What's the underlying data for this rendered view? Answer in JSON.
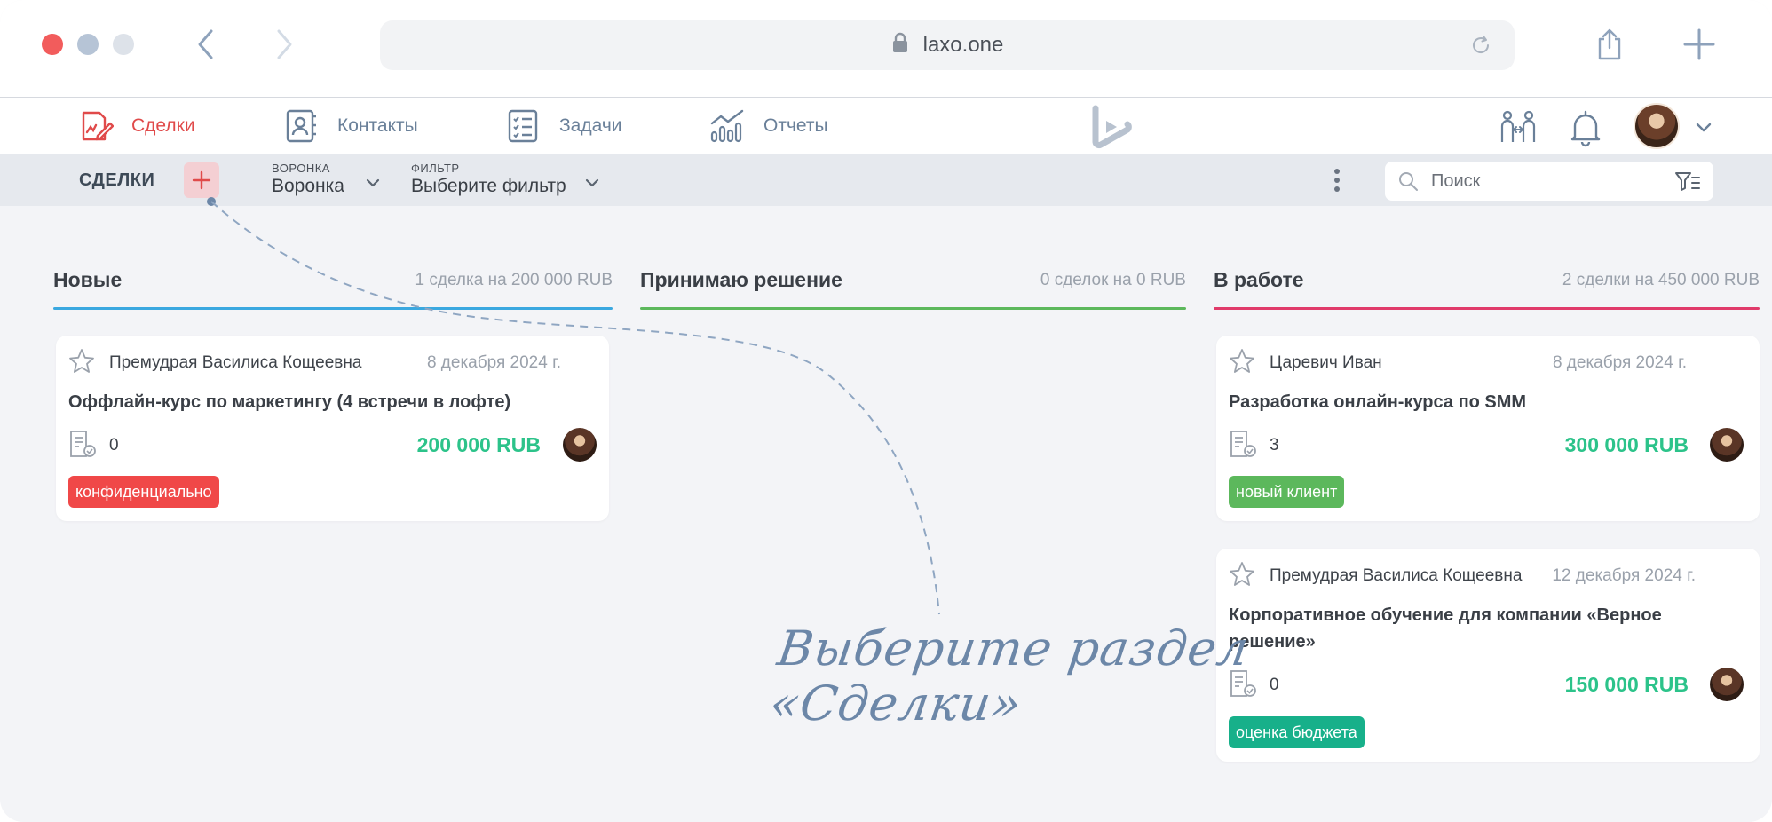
{
  "browser": {
    "url": "laxo.one"
  },
  "nav": {
    "items": [
      {
        "label": "Сделки",
        "icon": "deals-icon",
        "active": true
      },
      {
        "label": "Контакты",
        "icon": "contacts-icon",
        "active": false
      },
      {
        "label": "Задачи",
        "icon": "tasks-icon",
        "active": false
      },
      {
        "label": "Отчеты",
        "icon": "reports-icon",
        "active": false
      }
    ]
  },
  "toolbar": {
    "title": "СДЕЛКИ",
    "funnel_label": "ВОРОНКА",
    "funnel_value": "Воронка",
    "filter_label": "ФИЛЬТР",
    "filter_value": "Выберите фильтр",
    "search_placeholder": "Поиск"
  },
  "colors": {
    "accent": "#e04a4a",
    "amount": "#2cc38a",
    "col_new": "#3aa8e0",
    "col_decide": "#5cb85c",
    "col_work": "#e03a6a",
    "tag_confidential": "#f04848",
    "tag_new_client": "#5cb85c",
    "tag_budget": "#17b08a"
  },
  "columns": [
    {
      "name": "Новые",
      "summary": "1 сделка на 200 000 RUB",
      "cards": [
        {
          "owner": "Премудрая Василиса Кощеевна",
          "date": "8 декабря 2024 г.",
          "title": "Оффлайн-курс по маркетингу (4 встречи в лофте)",
          "count": "0",
          "amount": "200 000 RUB",
          "tag": "конфиденциально"
        }
      ]
    },
    {
      "name": "Принимаю решение",
      "summary": "0 сделок на 0 RUB",
      "cards": []
    },
    {
      "name": "В работе",
      "summary": "2 сделки на 450 000 RUB",
      "cards": [
        {
          "owner": "Царевич Иван",
          "date": "8 декабря 2024 г.",
          "title": "Разработка онлайн-курса по SMM",
          "count": "3",
          "amount": "300 000 RUB",
          "tag": "новый клиент"
        },
        {
          "owner": "Премудрая Василиса Кощеевна",
          "date": "12 декабря 2024 г.",
          "title": "Корпоративное обучение для компании «Верное решение»",
          "count": "0",
          "amount": "150 000 RUB",
          "tag": "оценка бюджета"
        }
      ]
    }
  ],
  "annotation": {
    "line1": "Выберите раздел",
    "line2": "«Сделки»"
  }
}
